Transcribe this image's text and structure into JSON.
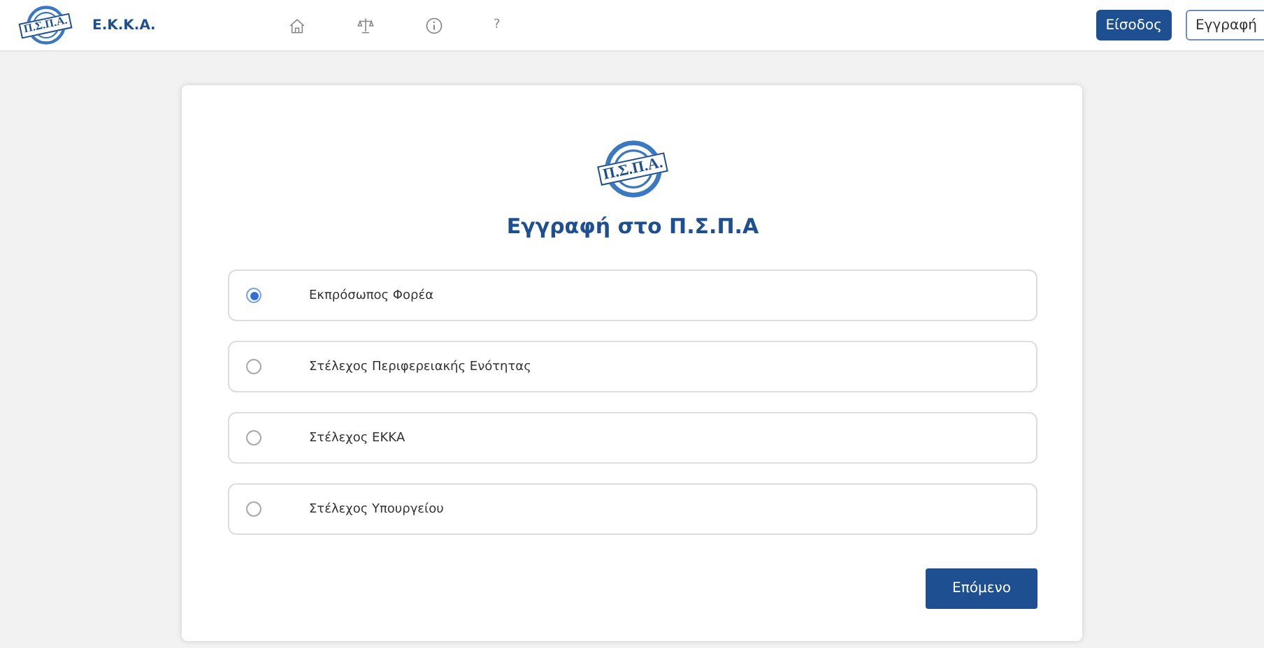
{
  "header": {
    "logo_text": "Π.Σ.Π.Α.",
    "brand": "Ε.Κ.Κ.Α.",
    "help": "?",
    "buttons": [
      {
        "label": "Είσοδος",
        "kind": "primary"
      },
      {
        "label": "Εγγραφή",
        "kind": "outline"
      }
    ]
  },
  "card": {
    "logo_text": "Π.Σ.Π.Α.",
    "title": "Εγγραφή στο Π.Σ.Π.Α",
    "options": [
      {
        "label": "Εκπρόσωπος Φορέα",
        "selected": true
      },
      {
        "label": "Στέλεχος Περιφερειακής Ενότητας",
        "selected": false
      },
      {
        "label": "Στέλεχος ΕΚΚΑ",
        "selected": false
      },
      {
        "label": "Στέλεχος Υπουργείου",
        "selected": false
      }
    ],
    "next_button": "Επόμενο"
  }
}
